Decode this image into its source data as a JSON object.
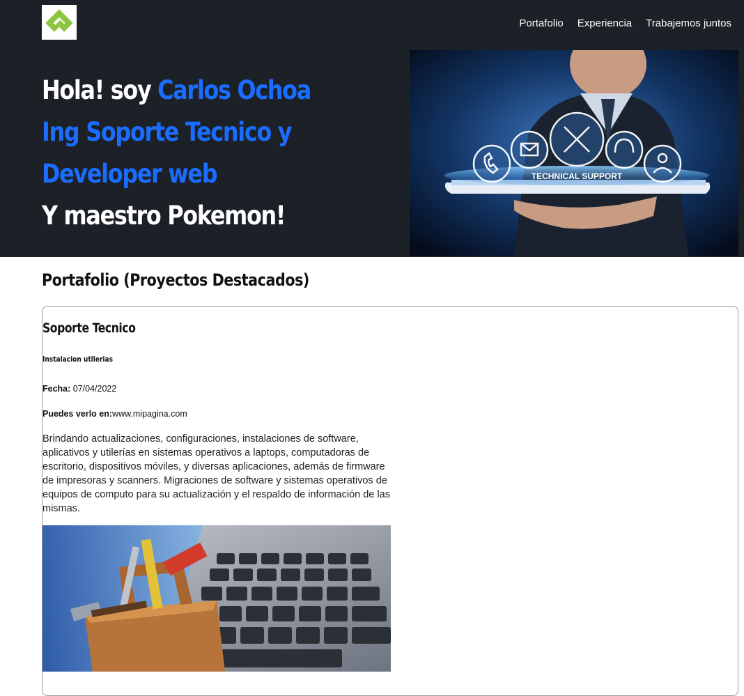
{
  "nav": {
    "items": [
      {
        "label": "Portafolio"
      },
      {
        "label": "Experiencia"
      },
      {
        "label": "Trabajemos juntos"
      }
    ]
  },
  "hero": {
    "greeting": "Hola! soy ",
    "name": "Carlos Ochoa",
    "role": "Ing Soporte Tecnico y Developer web",
    "tagline": "Y maestro Pokemon!",
    "image_caption": "TECHNICAL SUPPORT"
  },
  "portfolio": {
    "title": "Portafolio (Proyectos Destacados)",
    "project": {
      "title": "Soporte Tecnico",
      "subtitle": "Instalacion utilerias",
      "date_label": "Fecha:",
      "date": " 07/04/2022",
      "link_label": "Puedes verlo en:",
      "link": "www.mipagina.com",
      "description": "Brindando actualizaciones, configuraciones, instalaciones de software, aplicativos y utilerías en sistemas operativos a laptops, computadoras de escritorio, dispositivos móviles, y diversas aplicaciones, además de firmware de impresoras y scanners. Migraciones de software y sistemas operativos de equipos de computo para su actualización y el respaldo de información de las mismas."
    }
  },
  "colors": {
    "header_bg": "#1c2027",
    "accent_blue": "#1a6dff",
    "logo_green": "#8cc63f"
  }
}
